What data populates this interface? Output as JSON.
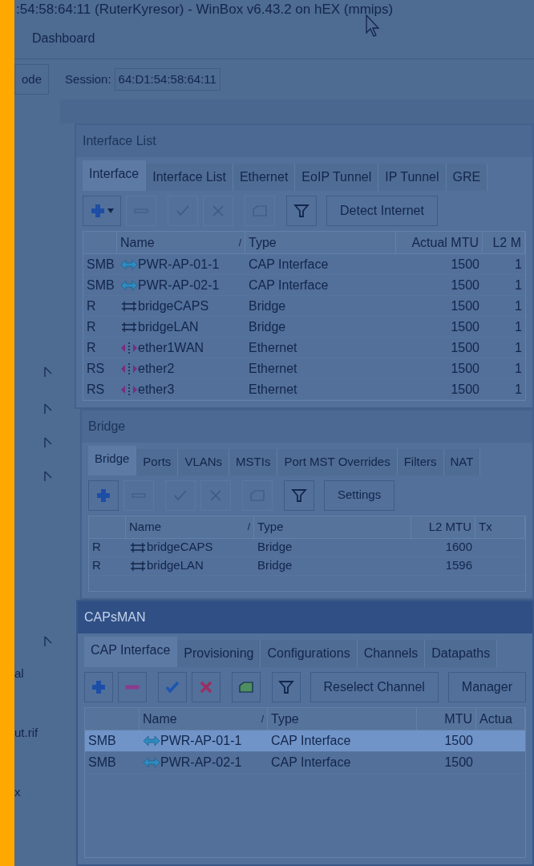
{
  "window": {
    "title": ":54:58:64:11 (RuterKyresor) - WinBox v6.43.2 on hEX (mmips)"
  },
  "menu": {
    "items": [
      "Dashboard"
    ]
  },
  "toolbar": {
    "button": "ode",
    "session_label": "Session:",
    "session_value": "64:D1:54:58:64:11"
  },
  "sidebar": {
    "items": [
      {
        "kind": "arrow"
      },
      {
        "kind": "arrow"
      },
      {
        "kind": "arrow"
      },
      {
        "kind": "arrow"
      },
      {
        "kind": "arrow"
      },
      {
        "kind": "text",
        "label": "al"
      },
      {
        "kind": "text",
        "label": "ut.rif"
      },
      {
        "kind": "text",
        "label": "x"
      }
    ]
  },
  "windows": [
    {
      "title": "Interface List",
      "active": false,
      "tabs": [
        {
          "label": "Interface",
          "selected": true
        },
        {
          "label": "Interface List",
          "selected": false
        },
        {
          "label": "Ethernet",
          "selected": false
        },
        {
          "label": "EoIP Tunnel",
          "selected": false
        },
        {
          "label": "IP Tunnel",
          "selected": false
        },
        {
          "label": "GRE",
          "selected": false
        }
      ],
      "tools": [
        {
          "kind": "add_menu",
          "disabled": false
        },
        {
          "kind": "remove",
          "disabled": true
        },
        {
          "kind": "enable",
          "disabled": true
        },
        {
          "kind": "disable",
          "disabled": true
        },
        {
          "kind": "comment",
          "disabled": true
        },
        {
          "kind": "filter",
          "disabled": false
        }
      ],
      "actions": [
        "Detect Internet"
      ],
      "columns": [
        {},
        {
          "label": "Name",
          "sort_mark": "/"
        },
        {
          "label": "Type"
        },
        {
          "label": "Actual MTU"
        },
        {
          "label": "L2 M"
        }
      ],
      "rows": [
        {
          "kind": "cap",
          "selected": false,
          "cells": [
            "SMB",
            "PWR-AP-01-1",
            "CAP Interface",
            "1500",
            "1"
          ]
        },
        {
          "kind": "cap",
          "selected": false,
          "cells": [
            "SMB",
            "PWR-AP-02-1",
            "CAP Interface",
            "1500",
            "1"
          ]
        },
        {
          "kind": "bridge",
          "selected": false,
          "cells": [
            "R",
            "bridgeCAPS",
            "Bridge",
            "1500",
            "1"
          ]
        },
        {
          "kind": "bridge",
          "selected": false,
          "cells": [
            "R",
            "bridgeLAN",
            "Bridge",
            "1500",
            "1"
          ]
        },
        {
          "kind": "ethernet",
          "selected": false,
          "cells": [
            "R",
            "ether1WAN",
            "Ethernet",
            "1500",
            "1"
          ]
        },
        {
          "kind": "ethernet",
          "selected": false,
          "cells": [
            "RS",
            "ether2",
            "Ethernet",
            "1500",
            "1"
          ]
        },
        {
          "kind": "ethernet",
          "selected": false,
          "cells": [
            "RS",
            "ether3",
            "Ethernet",
            "1500",
            "1"
          ]
        }
      ]
    },
    {
      "title": "Bridge",
      "active": false,
      "tabs": [
        {
          "label": "Bridge",
          "selected": true
        },
        {
          "label": "Ports",
          "selected": false
        },
        {
          "label": "VLANs",
          "selected": false
        },
        {
          "label": "MSTIs",
          "selected": false
        },
        {
          "label": "Port MST Overrides",
          "selected": false
        },
        {
          "label": "Filters",
          "selected": false
        },
        {
          "label": "NAT",
          "selected": false
        }
      ],
      "tools": [
        {
          "kind": "add",
          "disabled": false
        },
        {
          "kind": "remove",
          "disabled": true
        },
        {
          "kind": "enable",
          "disabled": true
        },
        {
          "kind": "disable",
          "disabled": true
        },
        {
          "kind": "comment",
          "disabled": true
        },
        {
          "kind": "filter",
          "disabled": false
        }
      ],
      "actions": [
        "Settings"
      ],
      "columns": [
        {},
        {
          "label": "Name",
          "sort_mark": "/"
        },
        {
          "label": "Type"
        },
        {
          "label": "L2 MTU"
        },
        {
          "label": "Tx"
        }
      ],
      "rows": [
        {
          "kind": "bridge",
          "selected": false,
          "cells": [
            "R",
            "bridgeCAPS",
            "Bridge",
            "1600"
          ]
        },
        {
          "kind": "bridge",
          "selected": false,
          "cells": [
            "R",
            "bridgeLAN",
            "Bridge",
            "1596"
          ]
        }
      ]
    },
    {
      "title": "CAPsMAN",
      "active": true,
      "tabs": [
        {
          "label": "CAP Interface",
          "selected": true
        },
        {
          "label": "Provisioning",
          "selected": false
        },
        {
          "label": "Configurations",
          "selected": false
        },
        {
          "label": "Channels",
          "selected": false
        },
        {
          "label": "Datapaths",
          "selected": false
        }
      ],
      "tools": [
        {
          "kind": "add",
          "disabled": false
        },
        {
          "kind": "remove",
          "disabled": false
        },
        {
          "kind": "enable",
          "disabled": false
        },
        {
          "kind": "disable",
          "disabled": false
        },
        {
          "kind": "comment",
          "disabled": false
        },
        {
          "kind": "filter",
          "disabled": false
        }
      ],
      "actions": [
        "Reselect Channel",
        "Manager"
      ],
      "columns": [
        {},
        {
          "label": "Name",
          "sort_mark": "/"
        },
        {
          "label": "Type"
        },
        {
          "label": "MTU"
        },
        {
          "label": "Actua"
        }
      ],
      "rows": [
        {
          "kind": "cap",
          "selected": true,
          "cells": [
            "SMB",
            "PWR-AP-01-1",
            "CAP Interface",
            "1500"
          ]
        },
        {
          "kind": "cap",
          "selected": false,
          "cells": [
            "SMB",
            "PWR-AP-02-1",
            "CAP Interface",
            "1500"
          ]
        }
      ]
    }
  ]
}
